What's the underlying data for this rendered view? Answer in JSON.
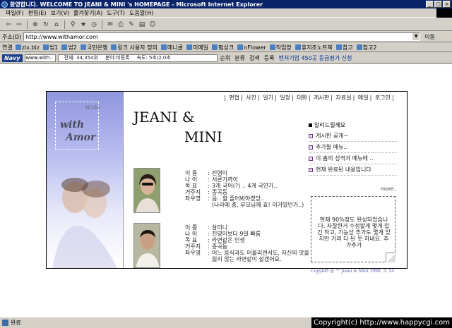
{
  "window": {
    "title": "환영합니다. WELCOME TO JEANI & MINI 's HOMEPAGE - Microsoft Internet Explorer",
    "buttons": [
      "_",
      "□",
      "×"
    ]
  },
  "menu": {
    "items": [
      "파일(F)",
      "편집(E)",
      "보기(V)",
      "즐겨찾기(A)",
      "도구(T)",
      "도움말(H)"
    ]
  },
  "toolbar": {
    "icons": [
      "back-icon",
      "forward-icon",
      "stop-icon",
      "refresh-icon",
      "home-icon",
      "search-icon",
      "favorites-icon",
      "history-icon",
      "mail-icon",
      "print-icon",
      "edit-icon",
      "discuss-icon",
      "messenger-icon"
    ]
  },
  "address": {
    "label": "주소(D)",
    "value": "http://www.withamor.com",
    "go_label": "이동"
  },
  "links": {
    "label": "연결",
    "items": [
      "zix.biz",
      "법1",
      "법2",
      "국민은행",
      "링크 사용자 정의",
      "메니클",
      "미메일",
      "펌싱크",
      "nFlower",
      "작업장",
      "휴지조노트북",
      "참고",
      "참고2"
    ]
  },
  "navy": {
    "logo": "Navy",
    "input": "www.with..",
    "stats": [
      "전체: 34,354위",
      "분야:미등록",
      "속도: 5초/2.0초"
    ],
    "buttons": [
      "순위",
      "분류",
      "검색",
      "등록"
    ],
    "promo": "벤처기업 450곳 동급평가 신청"
  },
  "site": {
    "nav": [
      "편협",
      "사진",
      "일기",
      "일정",
      "대화",
      "게시판",
      "자료실",
      "메일",
      "로그인"
    ],
    "logo_small": "W180",
    "logo_with": "with",
    "logo_amor": "Amor",
    "heading1": "JEANI &",
    "heading2": "MINI",
    "person1": [
      {
        "k": "이  름",
        "v": "진영이"
      },
      {
        "k": "나  이",
        "v": "서른가까이"
      },
      {
        "k": "목  표",
        "v": "3개 국어(?) .. 4개 국연가.."
      },
      {
        "k": "거주지",
        "v": "종곡동"
      },
      {
        "k": "좌우명",
        "v": "음.. 할 줄어봐야겠당.."
      }
    ],
    "person1_cont": "(나라에 충, 부모님께 효! 이거였던가..)",
    "person2": [
      {
        "k": "이  름",
        "v": "살미니"
      },
      {
        "k": "나  이",
        "v": "진영이보다 9일 빠름"
      },
      {
        "k": "목  표",
        "v": "라면같은 인생"
      },
      {
        "k": "거주지",
        "v": "종곡동"
      },
      {
        "k": "좌우명",
        "v": "어느 음식과도 어울리면서도, 자신의 맛을"
      }
    ],
    "person2_cont": "잃지 않는 라면같이 살겠어요.",
    "news_title": "알려드릴께요",
    "news": [
      "게시판 공개~",
      "추가될 메뉴..",
      "이 홈의 성격과 메뉴에 ..",
      "현재 완료된 내용입니다"
    ],
    "more": "more..",
    "note": "현재 90%정도 완성되었습니다. 자잘한거 수정할게 몇개 있긴 하고, 기능상 추가도 몇개 있지만 거의 다 된 듯 하네요. 추가추가",
    "copyright": "Copyleft @ ™ Jeani & Mini 1990. 3. 14"
  },
  "status": {
    "text": "완료",
    "watermark": "Copyright(c) http://www.happycgi.com"
  }
}
